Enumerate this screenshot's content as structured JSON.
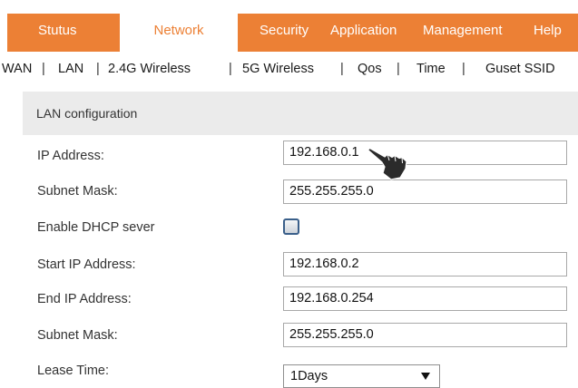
{
  "top_nav": {
    "tabs": [
      {
        "label": "Stutus",
        "active": false
      },
      {
        "label": "Network",
        "active": true
      },
      {
        "label": "Security",
        "active": false
      },
      {
        "label": "Application",
        "active": false
      },
      {
        "label": "Management",
        "active": false
      },
      {
        "label": "Help",
        "active": false
      }
    ],
    "accent_color": "#ec8035",
    "active_tab_color": "#ffffff"
  },
  "sub_nav": {
    "items": [
      "WAN",
      "LAN",
      "2.4G Wireless",
      "5G Wireless",
      "Qos",
      "Time",
      "Guset SSID"
    ],
    "separator": "|"
  },
  "section": {
    "title": "LAN configuration"
  },
  "form": {
    "ip_address": {
      "label": "IP Address:",
      "value": "192.168.0.1"
    },
    "subnet_mask": {
      "label": "Subnet Mask:",
      "value": "255.255.255.0"
    },
    "enable_dhcp": {
      "label": "Enable DHCP sever",
      "checked": false
    },
    "start_ip": {
      "label": "Start IP Address:",
      "value": "192.168.0.2"
    },
    "end_ip": {
      "label": "End IP Address:",
      "value": "192.168.0.254"
    },
    "dhcp_subnet_mask": {
      "label": "Subnet Mask:",
      "value": "255.255.255.0"
    },
    "lease_time": {
      "label": "Lease Time:",
      "selected": "1Days"
    }
  },
  "icons": {
    "pointer": "hand-pointer-icon",
    "dropdown_arrow": "triangle-down-icon"
  }
}
